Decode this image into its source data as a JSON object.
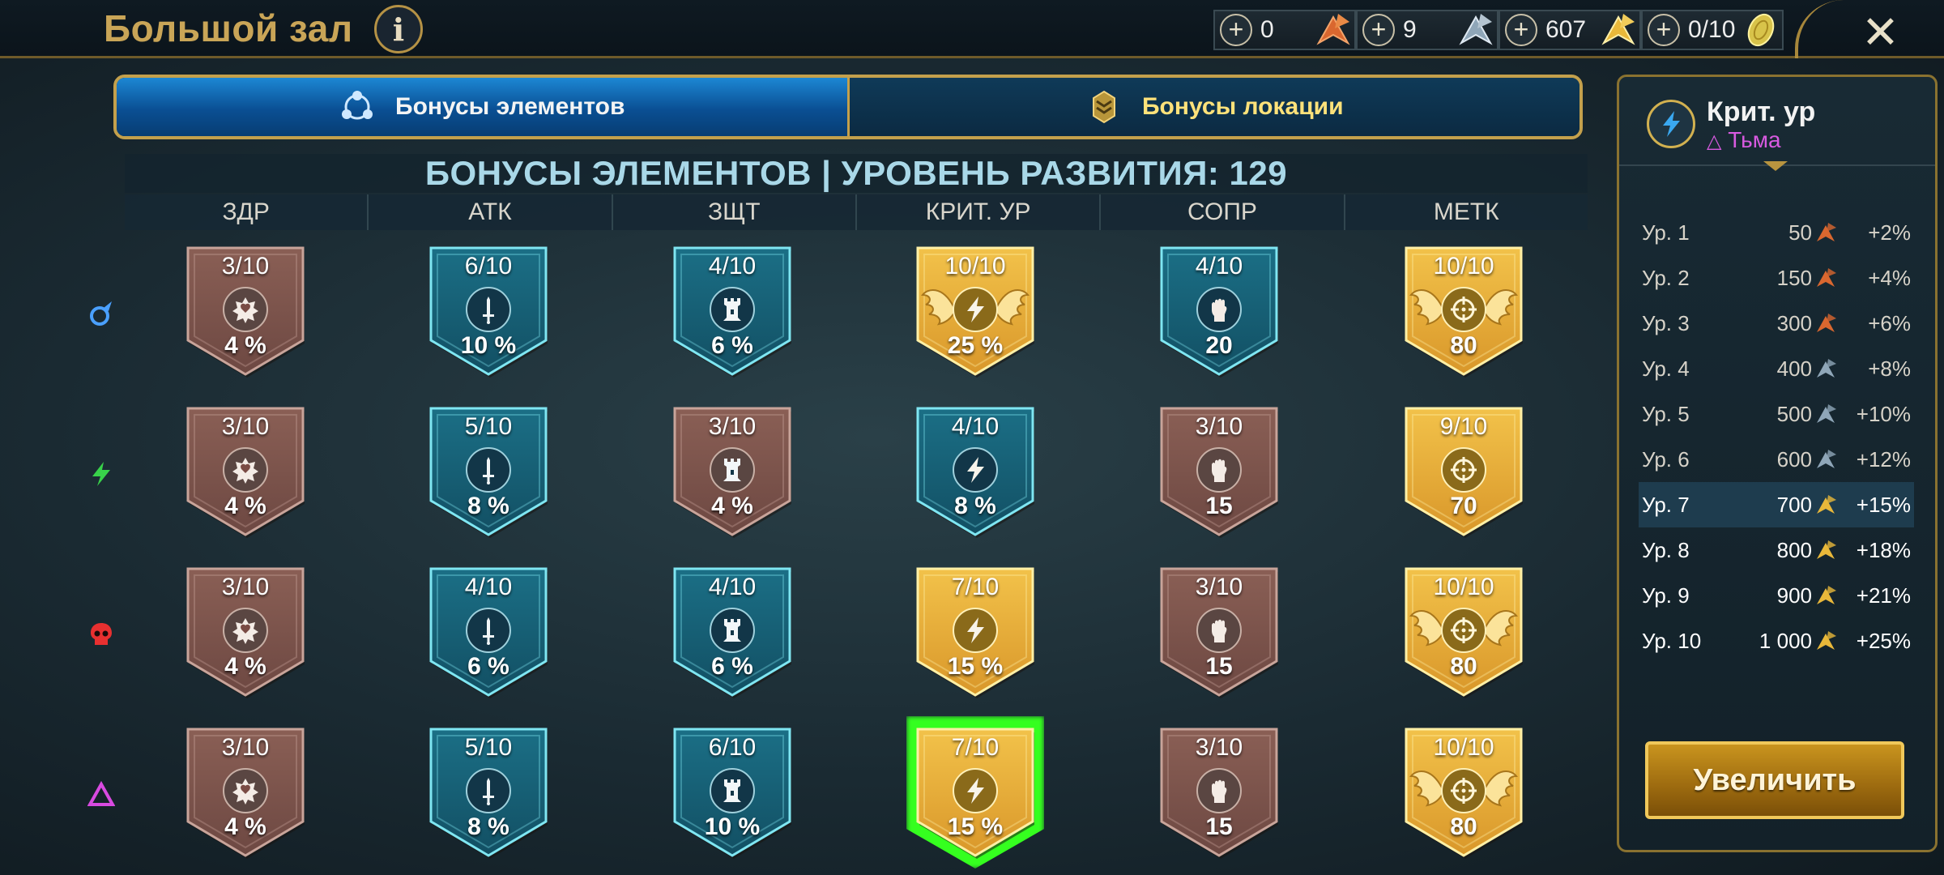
{
  "header": {
    "title": "Большой зал",
    "info_icon": "info-icon",
    "resources": [
      {
        "value": "0",
        "icon": "bronze-medal-icon",
        "color": "#e0703a"
      },
      {
        "value": "9",
        "icon": "silver-medal-icon",
        "color": "#8fa6b8"
      },
      {
        "value": "607",
        "icon": "gold-medal-icon",
        "color": "#e9b83a"
      },
      {
        "value": "0/10",
        "icon": "gold-coin-icon",
        "color": "#d8c34a"
      }
    ],
    "close_icon": "close-icon"
  },
  "tabs": [
    {
      "label": "Бонусы элементов",
      "icon": "elements-icon",
      "active": true
    },
    {
      "label": "Бонусы локации",
      "icon": "location-icon",
      "active": false
    }
  ],
  "grid": {
    "title": "БОНУСЫ ЭЛЕМЕНТОВ | УРОВЕНЬ РАЗВИТИЯ: 129",
    "columns": [
      "ЗДР",
      "АТК",
      "ЗЩТ",
      "КРИТ. УР",
      "СОПР",
      "МЕТК"
    ],
    "rows": [
      {
        "element_icon": "water-drop-icon",
        "color": "#4aa0ff",
        "cells": [
          {
            "level": "3/10",
            "value": "4 %",
            "tier": "brown",
            "icon": "health-icon"
          },
          {
            "level": "6/10",
            "value": "10 %",
            "tier": "teal",
            "icon": "sword-icon"
          },
          {
            "level": "4/10",
            "value": "6 %",
            "tier": "teal",
            "icon": "tower-icon"
          },
          {
            "level": "10/10",
            "value": "25 %",
            "tier": "gold-max",
            "icon": "lightning-icon"
          },
          {
            "level": "4/10",
            "value": "20",
            "tier": "teal",
            "icon": "fist-icon"
          },
          {
            "level": "10/10",
            "value": "80",
            "tier": "gold-max",
            "icon": "crosshair-icon"
          }
        ]
      },
      {
        "element_icon": "lightning-bolt-icon",
        "color": "#38d24a",
        "cells": [
          {
            "level": "3/10",
            "value": "4 %",
            "tier": "brown",
            "icon": "health-icon"
          },
          {
            "level": "5/10",
            "value": "8 %",
            "tier": "teal",
            "icon": "sword-icon"
          },
          {
            "level": "3/10",
            "value": "4 %",
            "tier": "brown",
            "icon": "tower-icon"
          },
          {
            "level": "4/10",
            "value": "8 %",
            "tier": "teal",
            "icon": "lightning-icon"
          },
          {
            "level": "3/10",
            "value": "15",
            "tier": "brown",
            "icon": "fist-icon"
          },
          {
            "level": "9/10",
            "value": "70",
            "tier": "gold",
            "icon": "crosshair-icon"
          }
        ]
      },
      {
        "element_icon": "skull-icon",
        "color": "#e83030",
        "cells": [
          {
            "level": "3/10",
            "value": "4 %",
            "tier": "brown",
            "icon": "health-icon"
          },
          {
            "level": "4/10",
            "value": "6 %",
            "tier": "teal",
            "icon": "sword-icon"
          },
          {
            "level": "4/10",
            "value": "6 %",
            "tier": "teal",
            "icon": "tower-icon"
          },
          {
            "level": "7/10",
            "value": "15 %",
            "tier": "gold",
            "icon": "lightning-icon"
          },
          {
            "level": "3/10",
            "value": "15",
            "tier": "brown",
            "icon": "fist-icon"
          },
          {
            "level": "10/10",
            "value": "80",
            "tier": "gold-max",
            "icon": "crosshair-icon"
          }
        ]
      },
      {
        "element_icon": "triangle-icon",
        "color": "#d84ae0",
        "cells": [
          {
            "level": "3/10",
            "value": "4 %",
            "tier": "brown",
            "icon": "health-icon"
          },
          {
            "level": "5/10",
            "value": "8 %",
            "tier": "teal",
            "icon": "sword-icon"
          },
          {
            "level": "6/10",
            "value": "10 %",
            "tier": "teal",
            "icon": "tower-icon"
          },
          {
            "level": "7/10",
            "value": "15 %",
            "tier": "gold",
            "icon": "lightning-icon",
            "selected": true
          },
          {
            "level": "3/10",
            "value": "15",
            "tier": "brown",
            "icon": "fist-icon"
          },
          {
            "level": "10/10",
            "value": "80",
            "tier": "gold-max",
            "icon": "crosshair-icon"
          }
        ]
      }
    ]
  },
  "panel": {
    "title": "Крит. ур",
    "subtitle": "Тьма",
    "subtitle_icon": "triangle-icon",
    "levels": [
      {
        "label": "Ур. 1",
        "cost": "50",
        "medal": "bronze",
        "bonus": "+2%"
      },
      {
        "label": "Ур. 2",
        "cost": "150",
        "medal": "bronze",
        "bonus": "+4%"
      },
      {
        "label": "Ур. 3",
        "cost": "300",
        "medal": "bronze",
        "bonus": "+6%"
      },
      {
        "label": "Ур. 4",
        "cost": "400",
        "medal": "silver",
        "bonus": "+8%"
      },
      {
        "label": "Ур. 5",
        "cost": "500",
        "medal": "silver",
        "bonus": "+10%"
      },
      {
        "label": "Ур. 6",
        "cost": "600",
        "medal": "silver",
        "bonus": "+12%"
      },
      {
        "label": "Ур. 7",
        "cost": "700",
        "medal": "gold",
        "bonus": "+15%",
        "current": true
      },
      {
        "label": "Ур. 8",
        "cost": "800",
        "medal": "gold",
        "bonus": "+18%"
      },
      {
        "label": "Ур. 9",
        "cost": "900",
        "medal": "gold",
        "bonus": "+21%"
      },
      {
        "label": "Ур. 10",
        "cost": "1 000",
        "medal": "gold",
        "bonus": "+25%"
      }
    ],
    "upgrade_label": "Увеличить"
  },
  "colors": {
    "gold_accent": "#c9a557",
    "tab_active": "#1c87d4",
    "selected_glow": "#35ff1f",
    "badge_brown": "#8a5f55",
    "badge_teal": "#1b6f86",
    "badge_gold": "#e9b233"
  }
}
